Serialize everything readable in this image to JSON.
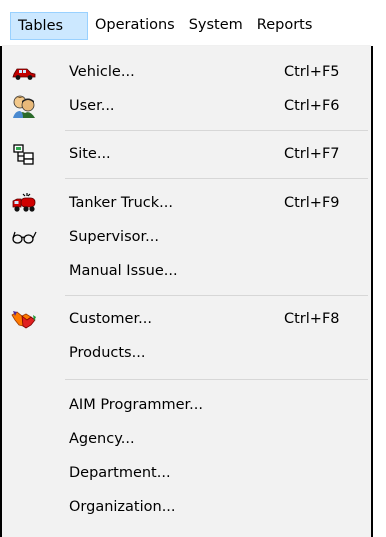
{
  "menubar": {
    "items": [
      {
        "label": "Tables",
        "active": true
      },
      {
        "label": "Operations",
        "active": false
      },
      {
        "label": "System",
        "active": false
      },
      {
        "label": "Reports",
        "active": false
      }
    ]
  },
  "tables_menu": {
    "items": [
      {
        "label": "Vehicle...",
        "shortcut": "Ctrl+F5",
        "icon": "car-icon"
      },
      {
        "label": "User...",
        "shortcut": "Ctrl+F6",
        "icon": "users-icon"
      },
      {
        "label": "Site...",
        "shortcut": "Ctrl+F7",
        "icon": "site-tree-icon"
      },
      {
        "label": "Tanker Truck...",
        "shortcut": "Ctrl+F9",
        "icon": "tanker-truck-icon"
      },
      {
        "label": "Supervisor...",
        "shortcut": "",
        "icon": "glasses-icon"
      },
      {
        "label": "Manual Issue...",
        "shortcut": "",
        "icon": ""
      },
      {
        "label": "Customer...",
        "shortcut": "Ctrl+F8",
        "icon": "handshake-icon"
      },
      {
        "label": "Products...",
        "shortcut": "",
        "icon": ""
      },
      {
        "label": "AIM Programmer...",
        "shortcut": "",
        "icon": ""
      },
      {
        "label": "Agency...",
        "shortcut": "",
        "icon": ""
      },
      {
        "label": "Department...",
        "shortcut": "",
        "icon": ""
      },
      {
        "label": "Organization...",
        "shortcut": "",
        "icon": ""
      }
    ]
  },
  "colors": {
    "menu_background": "#f2f2f2",
    "active_highlight": "#cce8ff",
    "active_border": "#99d1ff",
    "separator": "#d7d7d7"
  }
}
